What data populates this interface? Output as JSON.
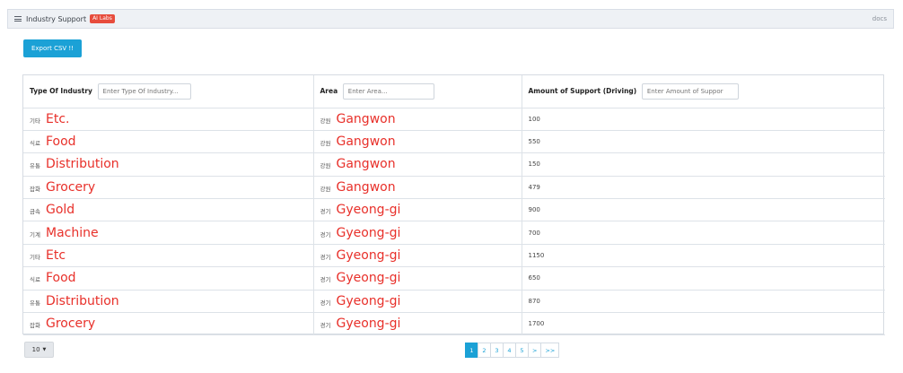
{
  "header": {
    "title": "Industry Support",
    "badge": "AI Labs",
    "docs": "docs"
  },
  "toolbar": {
    "export_label": "Export CSV !!"
  },
  "table": {
    "columns": [
      {
        "label": "Type Of Industry",
        "placeholder": "Enter Type Of Industry..."
      },
      {
        "label": "Area",
        "placeholder": "Enter Area..."
      },
      {
        "label": "Amount of Support (Driving)",
        "placeholder": "Enter Amount of Suppor"
      }
    ],
    "rows": [
      {
        "industry_kr": "기타",
        "industry_en": "Etc.",
        "area_kr": "강원",
        "area_en": "Gangwon",
        "amount": "100"
      },
      {
        "industry_kr": "식료",
        "industry_en": "Food",
        "area_kr": "강원",
        "area_en": "Gangwon",
        "amount": "550"
      },
      {
        "industry_kr": "유통",
        "industry_en": "Distribution",
        "area_kr": "강원",
        "area_en": "Gangwon",
        "amount": "150"
      },
      {
        "industry_kr": "잡화",
        "industry_en": "Grocery",
        "area_kr": "강원",
        "area_en": "Gangwon",
        "amount": "479"
      },
      {
        "industry_kr": "금속",
        "industry_en": "Gold",
        "area_kr": "경기",
        "area_en": "Gyeong-gi",
        "amount": "900"
      },
      {
        "industry_kr": "기계",
        "industry_en": "Machine",
        "area_kr": "경기",
        "area_en": "Gyeong-gi",
        "amount": "700"
      },
      {
        "industry_kr": "기타",
        "industry_en": "Etc",
        "area_kr": "경기",
        "area_en": "Gyeong-gi",
        "amount": "1150"
      },
      {
        "industry_kr": "식료",
        "industry_en": "Food",
        "area_kr": "경기",
        "area_en": "Gyeong-gi",
        "amount": "650"
      },
      {
        "industry_kr": "유통",
        "industry_en": "Distribution",
        "area_kr": "경기",
        "area_en": "Gyeong-gi",
        "amount": "870"
      },
      {
        "industry_kr": "잡화",
        "industry_en": "Grocery",
        "area_kr": "경기",
        "area_en": "Gyeong-gi",
        "amount": "1700"
      }
    ]
  },
  "footer": {
    "page_size": "10",
    "pages": [
      "1",
      "2",
      "3",
      "4",
      "5",
      ">",
      ">>"
    ],
    "active_page": "1"
  },
  "colors": {
    "accent": "#1ba1d6",
    "annotation_red": "#e8302a",
    "badge_red": "#e74c3c"
  },
  "icons": {
    "menu": "hamburger-menu-icon",
    "dropdown": "caret-down-icon"
  }
}
